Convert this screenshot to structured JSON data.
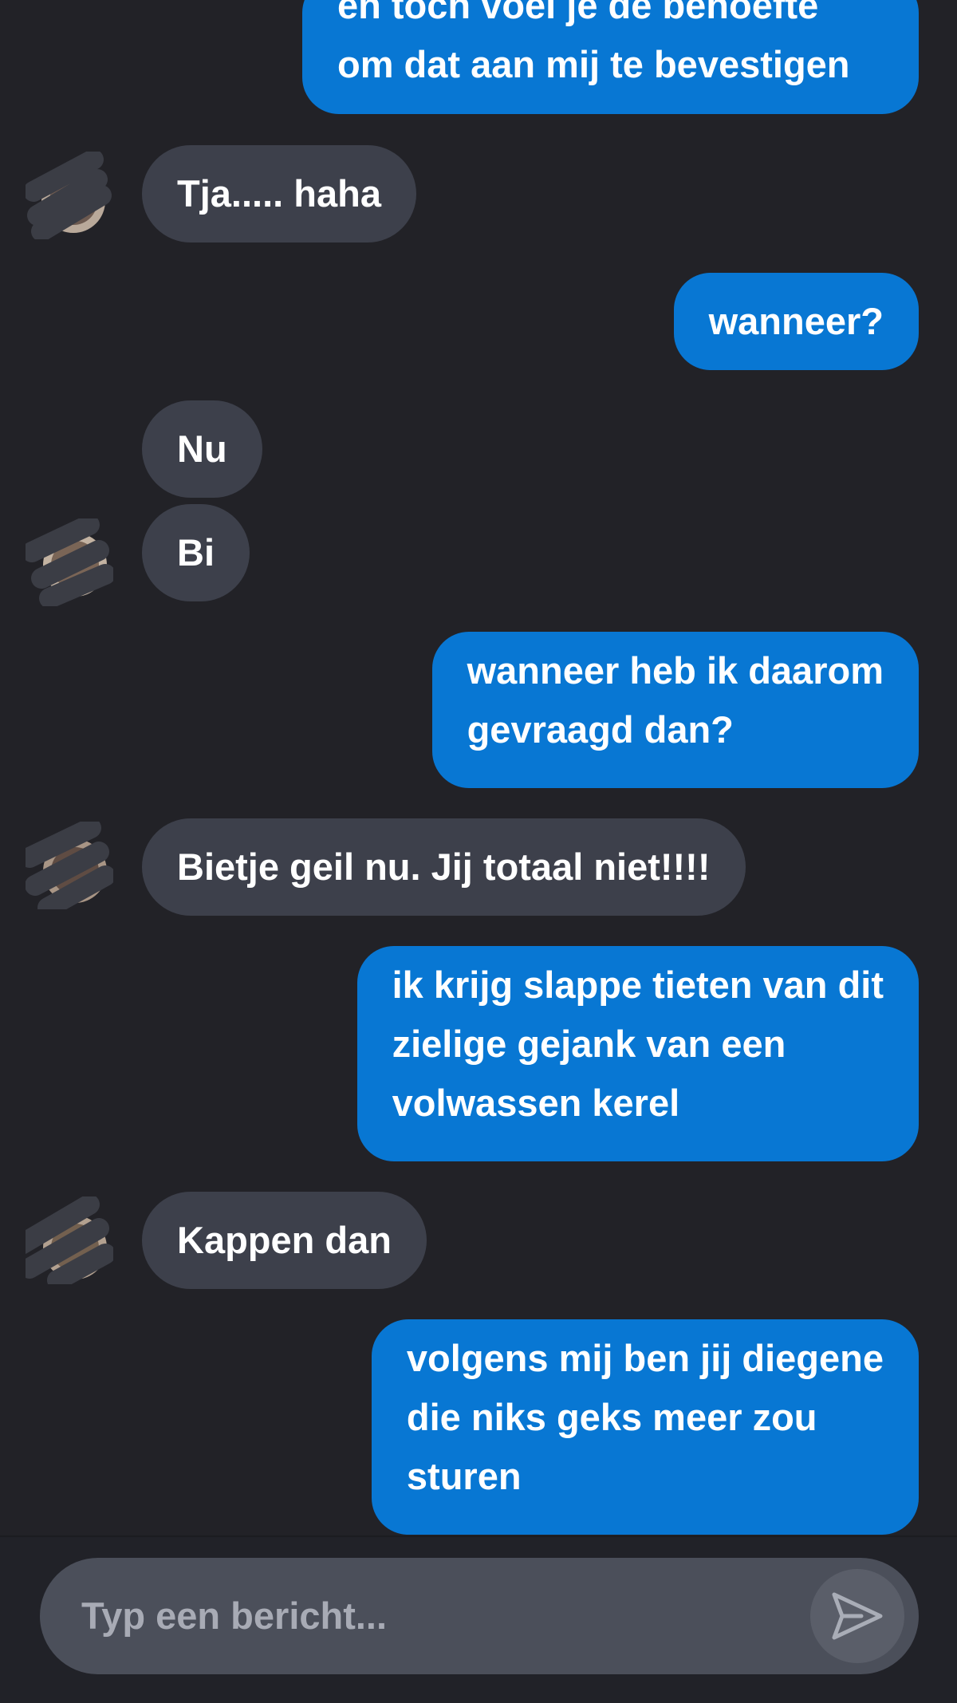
{
  "messages": [
    {
      "direction": "out",
      "text": "en toch voel je de behoefte\nom dat aan mij te bevestigen"
    },
    {
      "direction": "in",
      "text": "Tja..... haha"
    },
    {
      "direction": "out",
      "text": "wanneer?"
    },
    {
      "direction": "in",
      "text": "Nu"
    },
    {
      "direction": "in",
      "text": "Bi"
    },
    {
      "direction": "out",
      "text": "wanneer heb ik daarom\ngevraagd dan?"
    },
    {
      "direction": "in",
      "text": "Bietje geil nu. Jij totaal niet!!!!"
    },
    {
      "direction": "out",
      "text": "ik krijg slappe tieten van dit\nzielige gejank van een\nvolwassen kerel"
    },
    {
      "direction": "in",
      "text": "Kappen dan"
    },
    {
      "direction": "out",
      "text": "volgens mij ben jij diegene\ndie niks geks meer zou\nsturen"
    }
  ],
  "composer": {
    "placeholder": "Typ een bericht...",
    "send_icon": "send-icon"
  },
  "colors": {
    "background": "#222227",
    "outgoing_bubble": "#0877d3",
    "incoming_bubble": "#3d404b",
    "input_field": "#4b4f5a"
  }
}
